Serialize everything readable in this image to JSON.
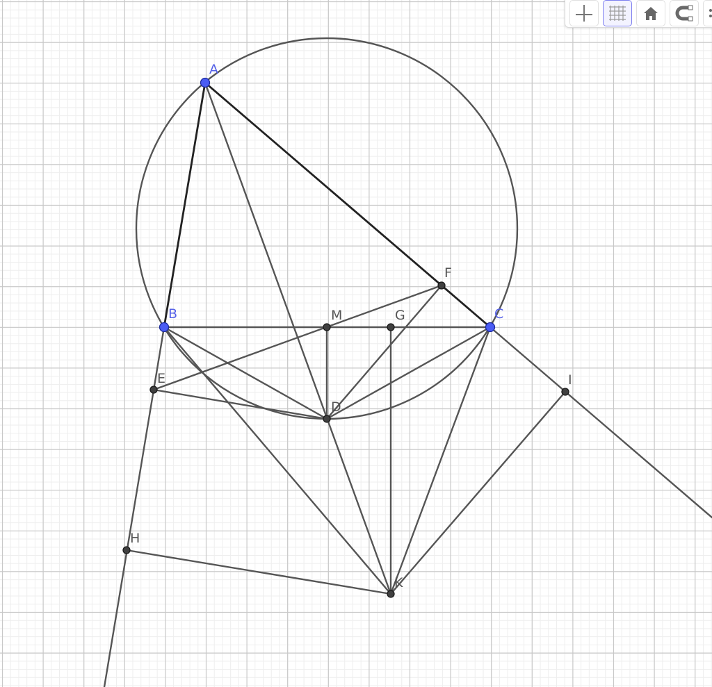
{
  "toolbar": {
    "buttons": [
      {
        "name": "axes-toggle-icon",
        "active": false
      },
      {
        "name": "grid-toggle-icon",
        "active": true
      },
      {
        "name": "home-icon",
        "active": false
      },
      {
        "name": "magnet-snap-icon",
        "active": false
      },
      {
        "name": "more-menu-icon",
        "active": false
      }
    ]
  },
  "colors": {
    "free_point": "#4a5cf4",
    "dependent_point": "#404040",
    "line": "#555555",
    "grid_major": "#c8c8c8",
    "grid_minor": "#eeeeee",
    "free_label": "#5561e8",
    "dependent_label": "#555555"
  },
  "construction": {
    "points": [
      {
        "name": "A",
        "free": true
      },
      {
        "name": "B",
        "free": true
      },
      {
        "name": "C",
        "free": true
      },
      {
        "name": "F",
        "free": false
      },
      {
        "name": "M",
        "free": false
      },
      {
        "name": "G",
        "free": false
      },
      {
        "name": "E",
        "free": false
      },
      {
        "name": "D",
        "free": false
      },
      {
        "name": "I",
        "free": false
      },
      {
        "name": "H",
        "free": false
      },
      {
        "name": "K",
        "free": false
      }
    ]
  }
}
